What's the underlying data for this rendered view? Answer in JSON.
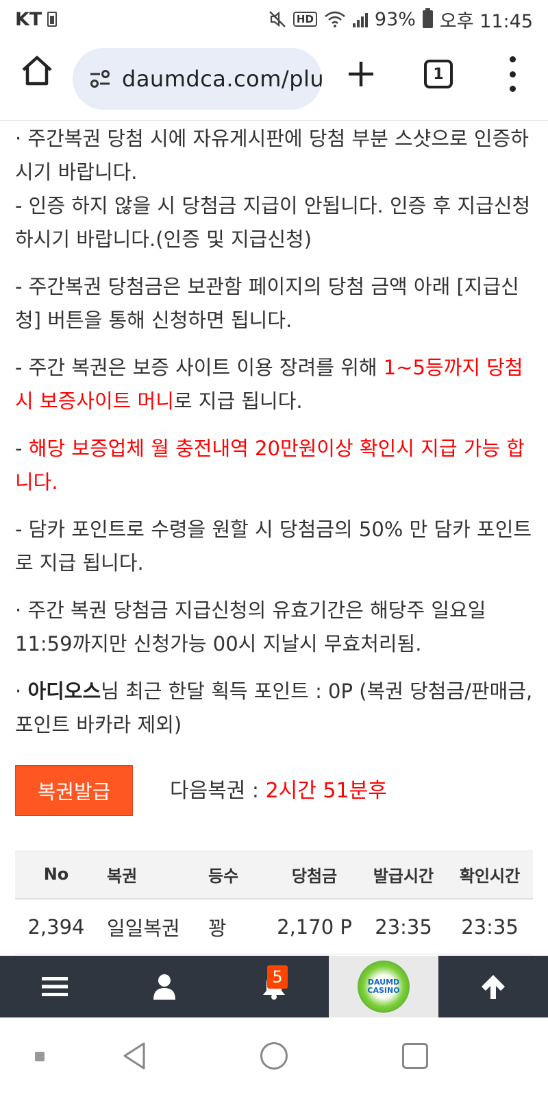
{
  "status_bar": {
    "carrier": "KT",
    "battery_percent": "93%",
    "time": "오후 11:45",
    "hd_label": "HD"
  },
  "browser": {
    "url": "daumdca.com/plu",
    "tab_count": "1"
  },
  "content": {
    "p1": " · 주간복권 당첨 시에 자유게시판에 당첨 부분 스샷으로 인증하시기 바랍니다.",
    "p2": "  - 인증 하지 않을 시 당첨금 지급이 안됩니다. 인증 후 지급신청 하시기 바랍니다.(인증 및 지급신청)",
    "p3": "  - 주간복권 당첨금은 보관함 페이지의 당첨 금액 아래 [지급신청] 버튼을 통해 신청하면 됩니다.",
    "p4_pre": "  - 주간 복권은 보증 사이트 이용 장려를 위해 ",
    "p4_red": "1~5등까지 당첨 시 보증사이트 머니",
    "p4_post": "로 지급 됩니다.",
    "p5_pre": "  - ",
    "p5_red": "해당 보증업체 월 충전내역 20만원이상 확인시 지급 가능 합니다.",
    "p6": "  - 담카 포인트로 수령을 원할 시 당첨금의 50% 만 담카 포인트로 지급 됩니다.",
    "p7": " · 주간 복권 당첨금 지급신청의 유효기간은 해당주 일요일 11:59까지만 신청가능 00시 지날시 무효처리됨.",
    "p8_pre": " · ",
    "p8_user": "아디오스",
    "p8_post": "님 최근 한달 획득 포인트 : 0P (복권 당첨금/판매금, 포인트 바카라 제외)"
  },
  "issue": {
    "button_label": "복권발급",
    "next_label": "다음복권 : ",
    "next_time": "2시간 51분후"
  },
  "table": {
    "headers": [
      "No",
      "복권",
      "등수",
      "당첨금",
      "발급시간",
      "확인시간"
    ],
    "rows": [
      [
        "2,394",
        "일일복권",
        "꽝",
        "2,170 P",
        "23:35",
        "23:35"
      ]
    ]
  },
  "site_nav": {
    "notification_count": "5",
    "logo_line1": "DAUMD",
    "logo_line2": "CASINO"
  },
  "colors": {
    "accent_red": "#ff0000",
    "button_orange": "#ff5722",
    "nav_dark": "#2f3640"
  }
}
